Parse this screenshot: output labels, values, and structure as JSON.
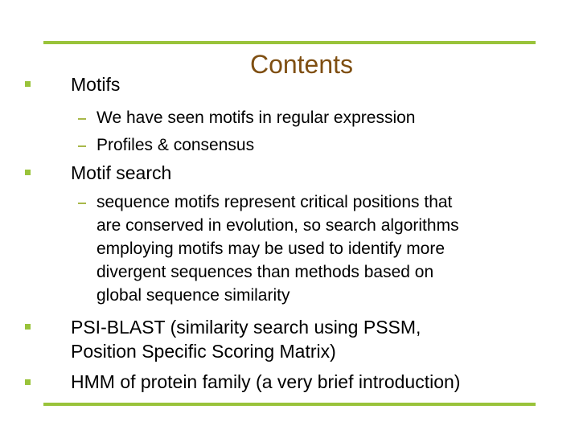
{
  "slide": {
    "title": "Contents",
    "accent_color": "#99c33a",
    "title_color": "#7f4f12",
    "bullets": [
      {
        "text": "Motifs",
        "sub": [
          "We have seen motifs in regular expression",
          "Profiles & consensus"
        ]
      },
      {
        "text": "Motif search",
        "sub_lines": [
          "sequence motifs represent critical positions that",
          "are conserved in evolution, so search algorithms",
          "employing motifs may be used to identify more",
          "divergent sequences than methods based on",
          "global sequence similarity"
        ]
      },
      {
        "lines": [
          "PSI-BLAST (similarity search using PSSM,",
          "Position Specific Scoring Matrix)"
        ]
      },
      {
        "text": "HMM of protein family (a very brief introduction)"
      }
    ]
  }
}
